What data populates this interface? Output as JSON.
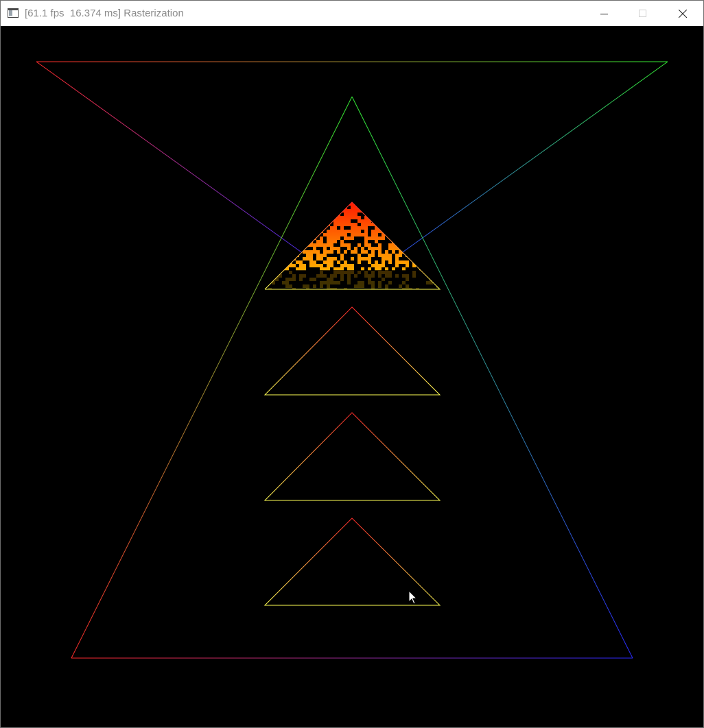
{
  "window": {
    "title": "[61.1 fps  16.374 ms] Rasterization",
    "controls": {
      "minimize_icon": "minimize-icon",
      "maximize_icon": "maximize-icon",
      "close_icon": "close-icon"
    }
  },
  "scene": {
    "background_color": "#000000",
    "colors": {
      "red": "#ff2a2a",
      "green": "#33dd33",
      "blue": "#2a2aff",
      "yellow": "#ffff55",
      "fill_top": "#ff2200",
      "fill_bottom": "#ffcc00"
    },
    "triangles": [
      {
        "name": "inverted-rgb-triangle",
        "edges": "red-green-blue"
      },
      {
        "name": "large-rgb-triangle",
        "edges": "green-red-blue"
      },
      {
        "name": "small-filled-triangle",
        "edges": "red-yellow",
        "filled": true
      },
      {
        "name": "small-outline-triangle-2",
        "edges": "red-yellow"
      },
      {
        "name": "small-outline-triangle-3",
        "edges": "red-yellow"
      },
      {
        "name": "small-outline-triangle-4",
        "edges": "red-yellow"
      }
    ],
    "cursor_icon": "mouse-pointer-icon"
  }
}
